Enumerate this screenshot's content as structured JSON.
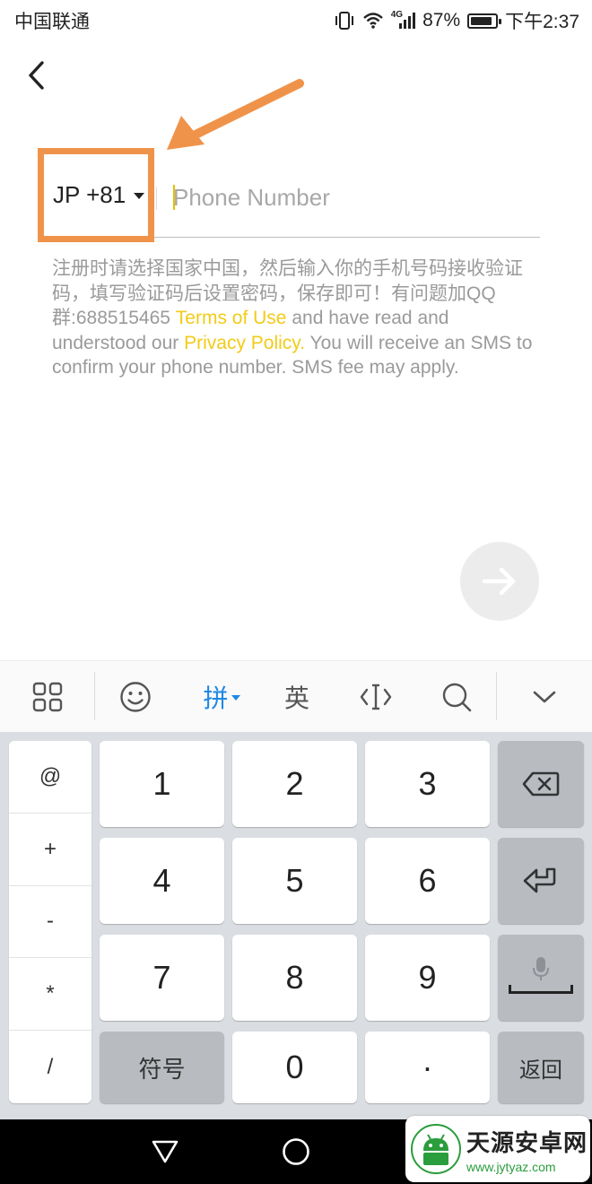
{
  "status_bar": {
    "carrier": "中国联通",
    "network": "4G",
    "battery": "87%",
    "battery_level": 0.87,
    "time": "下午2:37"
  },
  "form": {
    "country_code": "JP +81",
    "phone_placeholder": "Phone Number",
    "info_text": "注册时请选择国家中国，然后输入你的手机号码接收验证码，填写验证码后设置密码，保存即可！有问题加QQ群:688515465 ",
    "terms_link": "Terms of Use",
    "mid_text": " and have read and understood our ",
    "privacy_link": "Privacy Policy.",
    "tail_text": " You will receive an SMS to confirm your phone number. SMS fee may apply."
  },
  "annotation": {
    "color": "#f0934a"
  },
  "keyboard": {
    "toolbar": {
      "pinyin_label": "拼",
      "english_label": "英"
    },
    "symbols": [
      "@",
      "+",
      "-",
      "*",
      "/"
    ],
    "digits": [
      "1",
      "2",
      "3",
      "4",
      "5",
      "6",
      "7",
      "8",
      "9"
    ],
    "symbols_key": "符号",
    "zero": "0",
    "dot": "·",
    "return_key": "返回"
  },
  "watermark": {
    "title": "天源安卓网",
    "url": "www.jytyaz.com"
  },
  "colors": {
    "link": "#f2cb17",
    "accent_blue": "#1e88e5",
    "highlight_orange": "#f0934a"
  }
}
